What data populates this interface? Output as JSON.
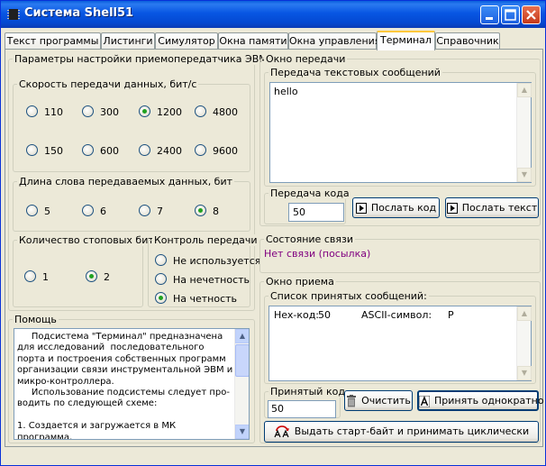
{
  "window": {
    "title": "Система Shell51"
  },
  "tabs": [
    {
      "label": "Текст программы"
    },
    {
      "label": "Листинги"
    },
    {
      "label": "Симулятор"
    },
    {
      "label": "Окна памяти"
    },
    {
      "label": "Окна управления"
    },
    {
      "label": "Терминал"
    },
    {
      "label": "Справочник"
    }
  ],
  "active_tab": "Терминал",
  "settings": {
    "title": "Параметры настройки приемопередатчика ЭВМ",
    "baud": {
      "title": "Скорость передачи данных, бит/с",
      "options": [
        "110",
        "300",
        "1200",
        "4800",
        "150",
        "600",
        "2400",
        "9600"
      ],
      "selected": "1200"
    },
    "wordlen": {
      "title": "Длина слова передаваемых данных, бит",
      "options": [
        "5",
        "6",
        "7",
        "8"
      ],
      "selected": "8"
    },
    "stopbits": {
      "title": "Количество стоповых бит",
      "options": [
        "1",
        "2"
      ],
      "selected": "2"
    },
    "parity": {
      "title": "Контроль передачи",
      "options": [
        "Не используется",
        "На нечетность",
        "На четность"
      ],
      "selected": "На четность"
    }
  },
  "help": {
    "title": "Помощь",
    "text": "     Подсистема \"Терминал\" предназначена для исследований  последовательного порта и построения собственных программ организации связи инструментальной ЭВМ и микро-контроллера.\n     Использование подсистемы следует про-водить по следующей схеме:\n\n1. Создается и загружается в МК программа,"
  },
  "send": {
    "title": "Окно передачи",
    "text_group_title": "Передача текстовых сообщений",
    "text_value": "hello",
    "code_title": "Передача кода",
    "code_value": "50",
    "send_code_label": "Послать код",
    "send_text_label": "Послать текст"
  },
  "status": {
    "title": "Состояние связи",
    "value": "Нет связи (посылка)",
    "value_color": "#800080"
  },
  "receive": {
    "title": "Окно приема",
    "list_title": "Список принятых сообщений:",
    "rows": [
      {
        "hex_label": "Hex-код:",
        "hex_value": "50",
        "ascii_label": "ASCII-символ:",
        "ascii_value": "P"
      }
    ],
    "code_title": "Принятый код",
    "code_value": "50",
    "clear_label": "Очистить",
    "once_label": "Принять однократно",
    "cyclic_label": "Выдать старт-байт и принимать циклически"
  }
}
